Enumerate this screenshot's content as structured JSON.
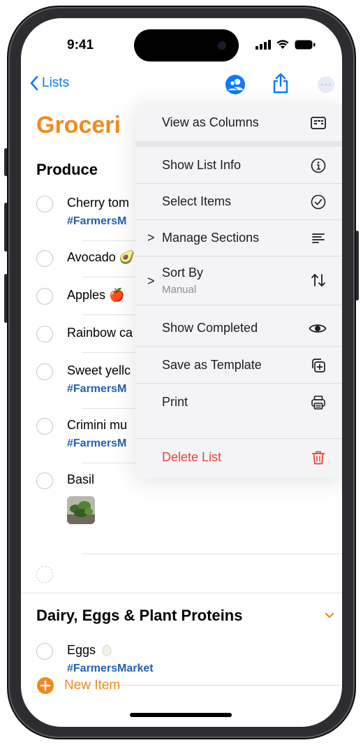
{
  "status_bar": {
    "time": "9:41"
  },
  "nav": {
    "back_label": "Lists"
  },
  "list": {
    "title": "Groceri"
  },
  "sections": [
    {
      "title": "Produce",
      "items": [
        {
          "text": "Cherry tom",
          "tag": "#FarmersM"
        },
        {
          "text": "Avocado",
          "emoji": "🥑"
        },
        {
          "text": "Apples",
          "emoji": "🍎"
        },
        {
          "text": "Rainbow ca"
        },
        {
          "text": "Sweet yellc",
          "tag": "#FarmersM"
        },
        {
          "text": "Crimini mu",
          "tag": "#FarmersM"
        },
        {
          "text": "Basil"
        }
      ]
    },
    {
      "title": "Dairy, Eggs & Plant Proteins",
      "items": [
        {
          "text": "Eggs",
          "tag": "#FarmersMarket"
        }
      ]
    }
  ],
  "menu": {
    "items": [
      {
        "label": "View as Columns",
        "icon": "columns-icon"
      },
      {
        "label": "Show List Info",
        "icon": "info-icon"
      },
      {
        "label": "Select Items",
        "icon": "checkmark-circle-icon"
      },
      {
        "label": "Manage Sections",
        "icon": "sections-icon",
        "chevron": ">"
      },
      {
        "label": "Sort By",
        "sublabel": "Manual",
        "icon": "sort-icon",
        "chevron": ">"
      },
      {
        "label": "Show Completed",
        "icon": "eye-icon"
      },
      {
        "label": "Save as Template",
        "icon": "template-icon"
      },
      {
        "label": "Print",
        "icon": "printer-icon"
      },
      {
        "label": "Delete List",
        "icon": "trash-icon",
        "destructive": true
      }
    ]
  },
  "footer": {
    "new_item_label": "New Item"
  },
  "colors": {
    "accent": "#f08b1b",
    "link": "#0a7aff",
    "tag": "#2560b2",
    "destructive": "#ea4335"
  }
}
